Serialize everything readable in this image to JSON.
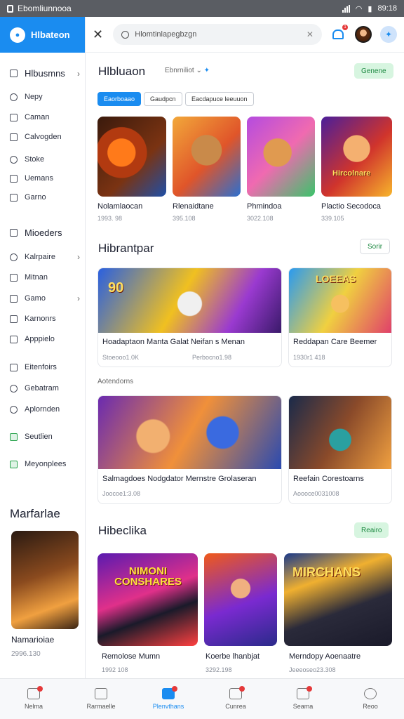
{
  "status": {
    "carrier": "Ebomliunnooa",
    "time": "89:18"
  },
  "sidebar": {
    "brand": "Hlbateon",
    "items": [
      {
        "label": "Hlbusmns"
      },
      {
        "label": "Nepy"
      },
      {
        "label": "Caman"
      },
      {
        "label": "Calvogden"
      },
      {
        "label": "Stoke"
      },
      {
        "label": "Uemans"
      },
      {
        "label": "Garno"
      },
      {
        "label": "Mioeders"
      },
      {
        "label": "Kalrpaire"
      },
      {
        "label": "Mitnan"
      },
      {
        "label": "Gamo"
      },
      {
        "label": "Karnonrs"
      },
      {
        "label": "Apppielo"
      },
      {
        "label": "Eitenfoirs"
      },
      {
        "label": "Gebatram"
      },
      {
        "label": "Aplornden"
      },
      {
        "label": "Seutlien"
      },
      {
        "label": "Meyonplees"
      }
    ],
    "featured_heading": "Marfarlae",
    "featured_card": {
      "title": "Namarioiae",
      "meta": "2996.130"
    }
  },
  "topbar": {
    "search_value": "Hlomtinlapegbzgn",
    "notification_count": "1"
  },
  "section1": {
    "title": "Hlbluaon",
    "filter_label": "Ebnrniliot",
    "action": "Genene",
    "chips": [
      "Eaorboaao",
      "Gaudpcn",
      "Eacdapuce leeuuon"
    ],
    "cards": [
      {
        "title": "Nolamlaocan",
        "meta": "1993. 98"
      },
      {
        "title": "Rlenaidtane",
        "meta": "395.108"
      },
      {
        "title": "Phmindoa",
        "meta": "3022.108"
      },
      {
        "title": "Plactio Secodoca",
        "meta": "339.105",
        "art_text": "Hircolnare"
      }
    ]
  },
  "section2": {
    "title": "Hibrantpar",
    "action": "Sorir",
    "banners": [
      {
        "title": "Hoadaptaon Manta Galat  Neifan s Menan",
        "meta": "Stoeooo1.0K",
        "meta2": "Perbocno1.98",
        "art_text": "90"
      },
      {
        "title": "Reddapan Care Beemer",
        "meta": "1930r1 418",
        "art_text": "LOEEAS"
      }
    ]
  },
  "section3": {
    "label": "Aotendorns",
    "banners": [
      {
        "title": "Salmagdoes Nodgdator Mernstre Grolaseran",
        "meta": "Joocoe1:3.08"
      },
      {
        "title": "Reefain Corestoarns",
        "meta": "Aoooce0031008"
      }
    ]
  },
  "section4": {
    "title": "Hibeclika",
    "action": "Reairo",
    "cards": [
      {
        "title": "Remolose Mumn",
        "meta": "1992 108",
        "art_text": "NIMONI CONSHARES"
      },
      {
        "title": "Koerbe lhanbjat",
        "meta": "3292.198"
      },
      {
        "title": "Merndopy Aoenaatre",
        "meta": "Jeeeoseo23.308",
        "art_text": "MIRCHANS"
      }
    ]
  },
  "bottomnav": [
    {
      "label": "Nelma",
      "badge": true
    },
    {
      "label": "Rarmaelle",
      "badge": false
    },
    {
      "label": "Plenvthans",
      "badge": true,
      "active": true
    },
    {
      "label": "Cunrea",
      "badge": true
    },
    {
      "label": "Seama",
      "badge": true
    },
    {
      "label": "Reoo",
      "badge": false
    }
  ]
}
